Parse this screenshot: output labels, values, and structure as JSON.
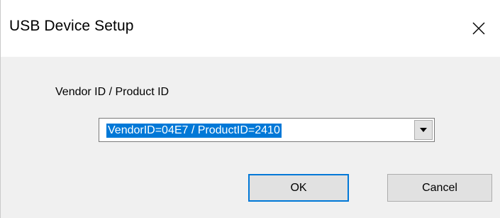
{
  "window": {
    "title": "USB Device Setup"
  },
  "form": {
    "label": "Vendor ID / Product ID",
    "selected_value": "VendorID=04E7 / ProductID=2410"
  },
  "buttons": {
    "ok_label": "OK",
    "cancel_label": "Cancel"
  },
  "icons": {
    "close": "close-icon",
    "dropdown": "chevron-down-icon"
  },
  "colors": {
    "selection": "#0078d7",
    "dialog_bg": "#f0f0f0",
    "button_bg": "#e1e1e1"
  }
}
